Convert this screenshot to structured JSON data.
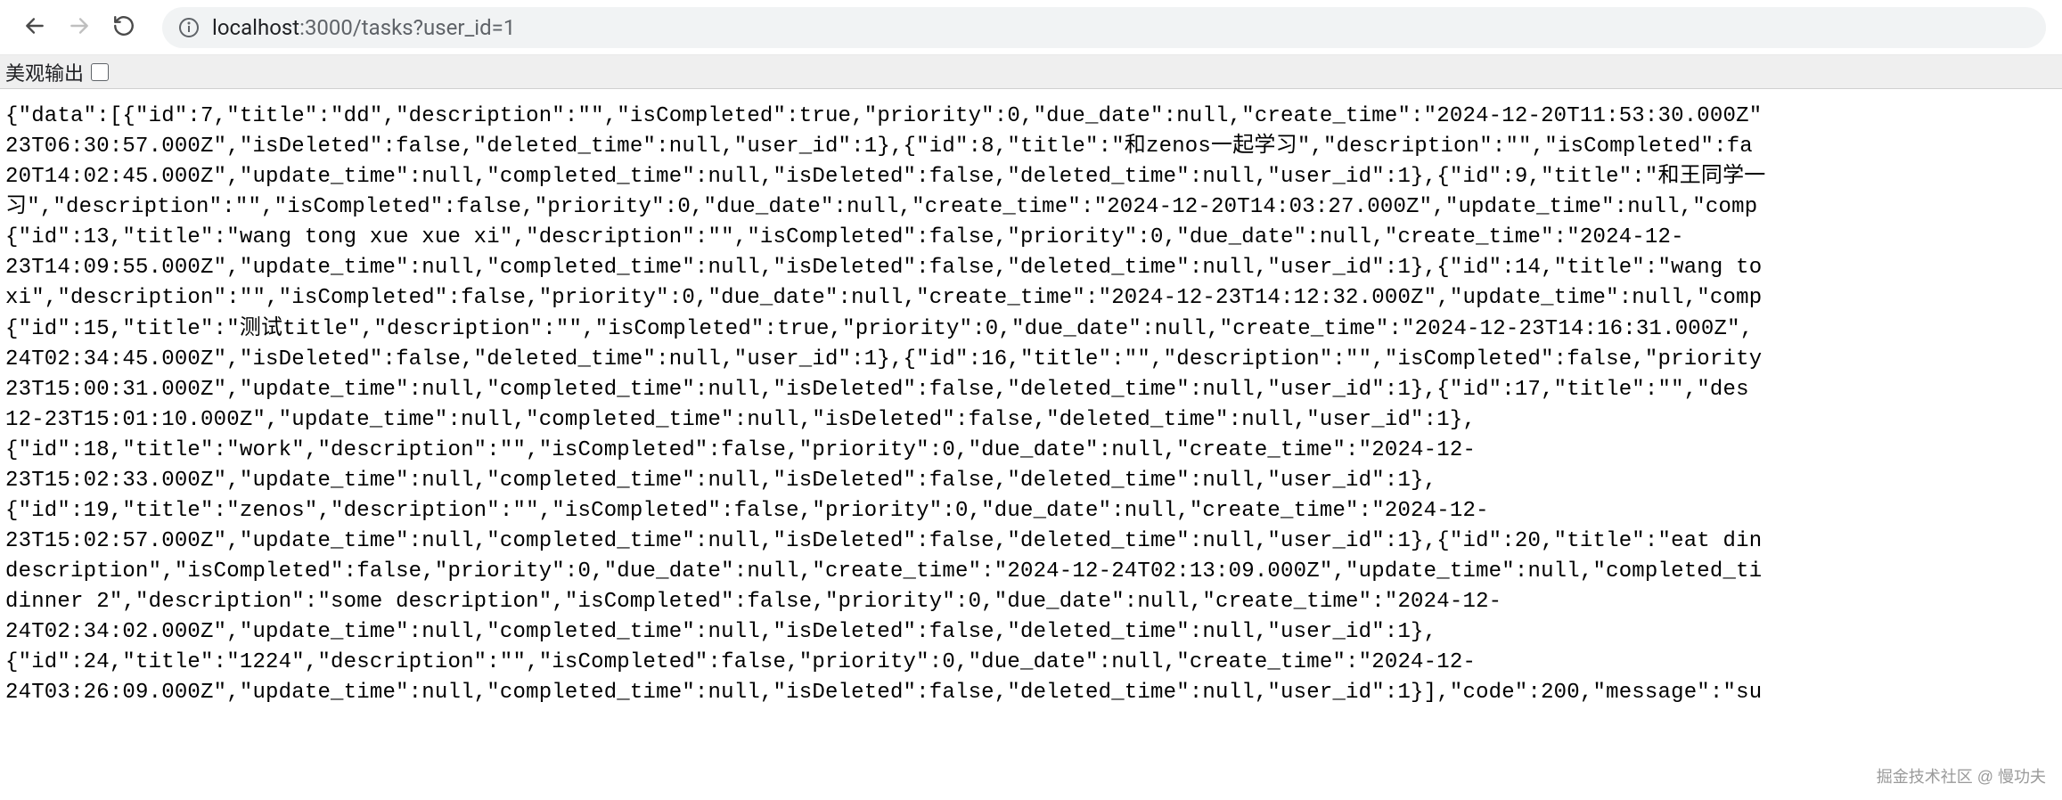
{
  "toolbar": {
    "url_host": "localhost",
    "url_rest": ":3000/tasks?user_id=1"
  },
  "pretty_bar": {
    "label": "美观输出"
  },
  "json_text": "{\"data\":[{\"id\":7,\"title\":\"dd\",\"description\":\"\",\"isCompleted\":true,\"priority\":0,\"due_date\":null,\"create_time\":\"2024-12-20T11:53:30.000Z\"\n23T06:30:57.000Z\",\"isDeleted\":false,\"deleted_time\":null,\"user_id\":1},{\"id\":8,\"title\":\"和zenos一起学习\",\"description\":\"\",\"isCompleted\":fa\n20T14:02:45.000Z\",\"update_time\":null,\"completed_time\":null,\"isDeleted\":false,\"deleted_time\":null,\"user_id\":1},{\"id\":9,\"title\":\"和王同学一\n习\",\"description\":\"\",\"isCompleted\":false,\"priority\":0,\"due_date\":null,\"create_time\":\"2024-12-20T14:03:27.000Z\",\"update_time\":null,\"comp\n{\"id\":13,\"title\":\"wang tong xue xue xi\",\"description\":\"\",\"isCompleted\":false,\"priority\":0,\"due_date\":null,\"create_time\":\"2024-12-\n23T14:09:55.000Z\",\"update_time\":null,\"completed_time\":null,\"isDeleted\":false,\"deleted_time\":null,\"user_id\":1},{\"id\":14,\"title\":\"wang to\nxi\",\"description\":\"\",\"isCompleted\":false,\"priority\":0,\"due_date\":null,\"create_time\":\"2024-12-23T14:12:32.000Z\",\"update_time\":null,\"comp\n{\"id\":15,\"title\":\"测试title\",\"description\":\"\",\"isCompleted\":true,\"priority\":0,\"due_date\":null,\"create_time\":\"2024-12-23T14:16:31.000Z\",\n24T02:34:45.000Z\",\"isDeleted\":false,\"deleted_time\":null,\"user_id\":1},{\"id\":16,\"title\":\"\",\"description\":\"\",\"isCompleted\":false,\"priority\n23T15:00:31.000Z\",\"update_time\":null,\"completed_time\":null,\"isDeleted\":false,\"deleted_time\":null,\"user_id\":1},{\"id\":17,\"title\":\"\",\"des\n12-23T15:01:10.000Z\",\"update_time\":null,\"completed_time\":null,\"isDeleted\":false,\"deleted_time\":null,\"user_id\":1},\n{\"id\":18,\"title\":\"work\",\"description\":\"\",\"isCompleted\":false,\"priority\":0,\"due_date\":null,\"create_time\":\"2024-12-\n23T15:02:33.000Z\",\"update_time\":null,\"completed_time\":null,\"isDeleted\":false,\"deleted_time\":null,\"user_id\":1},\n{\"id\":19,\"title\":\"zenos\",\"description\":\"\",\"isCompleted\":false,\"priority\":0,\"due_date\":null,\"create_time\":\"2024-12-\n23T15:02:57.000Z\",\"update_time\":null,\"completed_time\":null,\"isDeleted\":false,\"deleted_time\":null,\"user_id\":1},{\"id\":20,\"title\":\"eat din\ndescription\",\"isCompleted\":false,\"priority\":0,\"due_date\":null,\"create_time\":\"2024-12-24T02:13:09.000Z\",\"update_time\":null,\"completed_ti\ndinner 2\",\"description\":\"some description\",\"isCompleted\":false,\"priority\":0,\"due_date\":null,\"create_time\":\"2024-12-\n24T02:34:02.000Z\",\"update_time\":null,\"completed_time\":null,\"isDeleted\":false,\"deleted_time\":null,\"user_id\":1},\n{\"id\":24,\"title\":\"1224\",\"description\":\"\",\"isCompleted\":false,\"priority\":0,\"due_date\":null,\"create_time\":\"2024-12-\n24T03:26:09.000Z\",\"update_time\":null,\"completed_time\":null,\"isDeleted\":false,\"deleted_time\":null,\"user_id\":1}],\"code\":200,\"message\":\"su",
  "watermark": "掘金技术社区 @ 慢功夫"
}
